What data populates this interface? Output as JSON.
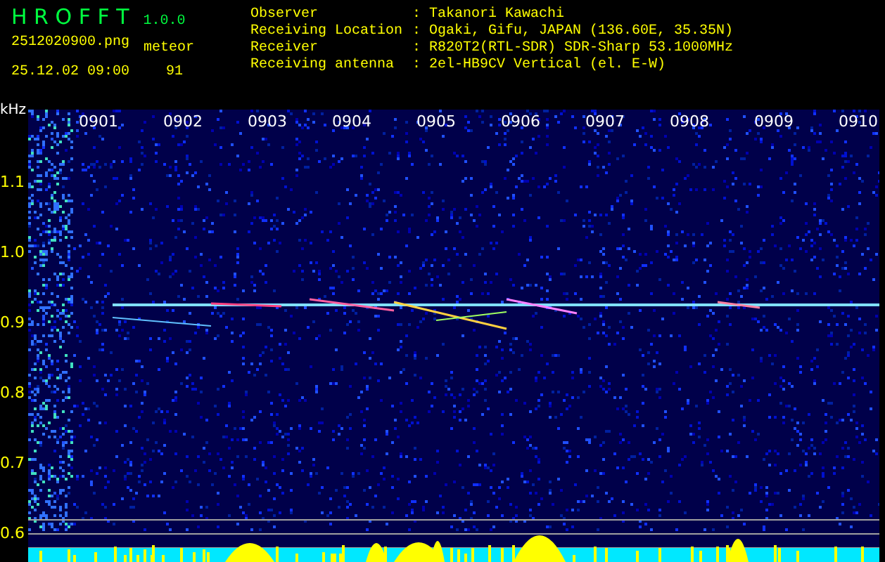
{
  "app": {
    "title": "H R O F F T",
    "version": "1.0.0"
  },
  "file": {
    "name": "2512020900.png",
    "datetime": "25.12.02 09:00"
  },
  "count": {
    "label": "meteor",
    "value": "91"
  },
  "info": [
    {
      "label": "Observer",
      "value": ": Takanori Kawachi"
    },
    {
      "label": "Receiving Location",
      "value": ": Ogaki, Gifu, JAPAN (136.60E, 35.35N)"
    },
    {
      "label": "Receiver",
      "value": ": R820T2(RTL-SDR) SDR-Sharp 53.1000MHz"
    },
    {
      "label": "Receiving antenna",
      "value": ": 2el-HB9CV Vertical (el. E-W)"
    }
  ],
  "spectrogram": {
    "y_unit": "kHz",
    "y_labels": [
      "1.1",
      "1.0",
      "0.9",
      "0.8",
      "0.7",
      "0.6"
    ],
    "x_labels": [
      "0901",
      "0902",
      "0903",
      "0904",
      "0905",
      "0906",
      "0907",
      "0908",
      "0909",
      "0910"
    ]
  }
}
